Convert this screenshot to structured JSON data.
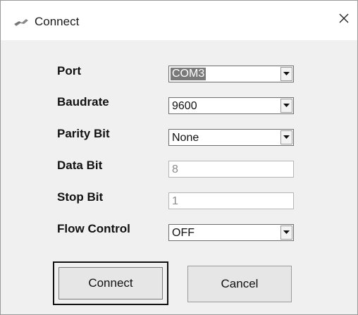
{
  "window": {
    "title": "Connect",
    "close_icon": "close-icon"
  },
  "form": {
    "port": {
      "label": "Port",
      "value": "COM3"
    },
    "baudrate": {
      "label": "Baudrate",
      "value": "9600"
    },
    "parity_bit": {
      "label": "Parity Bit",
      "value": "None"
    },
    "data_bit": {
      "label": "Data Bit",
      "value": "8"
    },
    "stop_bit": {
      "label": "Stop Bit",
      "value": "1"
    },
    "flow_control": {
      "label": "Flow Control",
      "value": "OFF"
    }
  },
  "buttons": {
    "connect_label": "Connect",
    "cancel_label": "Cancel"
  }
}
